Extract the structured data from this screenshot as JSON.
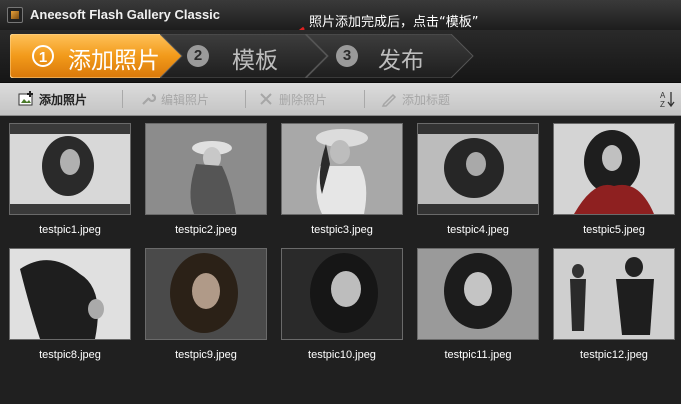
{
  "window": {
    "title": "Aneesoft Flash Gallery Classic",
    "hint": "照片添加完成后，点击“模板”"
  },
  "steps": [
    {
      "number": "1",
      "label": "添加照片",
      "active": true
    },
    {
      "number": "2",
      "label": "模板",
      "active": false
    },
    {
      "number": "3",
      "label": "发布",
      "active": false
    }
  ],
  "toolbar": {
    "add_photo": "添加照片",
    "edit_photo": "编辑照片",
    "delete_photo": "删除照片",
    "add_caption": "添加标题",
    "sort_icon": "sort-az-icon"
  },
  "photos": [
    {
      "name": "testpic1.jpeg"
    },
    {
      "name": "testpic2.jpeg"
    },
    {
      "name": "testpic3.jpeg"
    },
    {
      "name": "testpic4.jpeg"
    },
    {
      "name": "testpic5.jpeg"
    },
    {
      "name": "testpic8.jpeg"
    },
    {
      "name": "testpic9.jpeg"
    },
    {
      "name": "testpic10.jpeg"
    },
    {
      "name": "testpic11.jpeg"
    },
    {
      "name": "testpic12.jpeg"
    }
  ],
  "colors": {
    "active_step": "#f29a1a",
    "hint_arrow": "#e02020",
    "background": "#1c1c1c"
  }
}
